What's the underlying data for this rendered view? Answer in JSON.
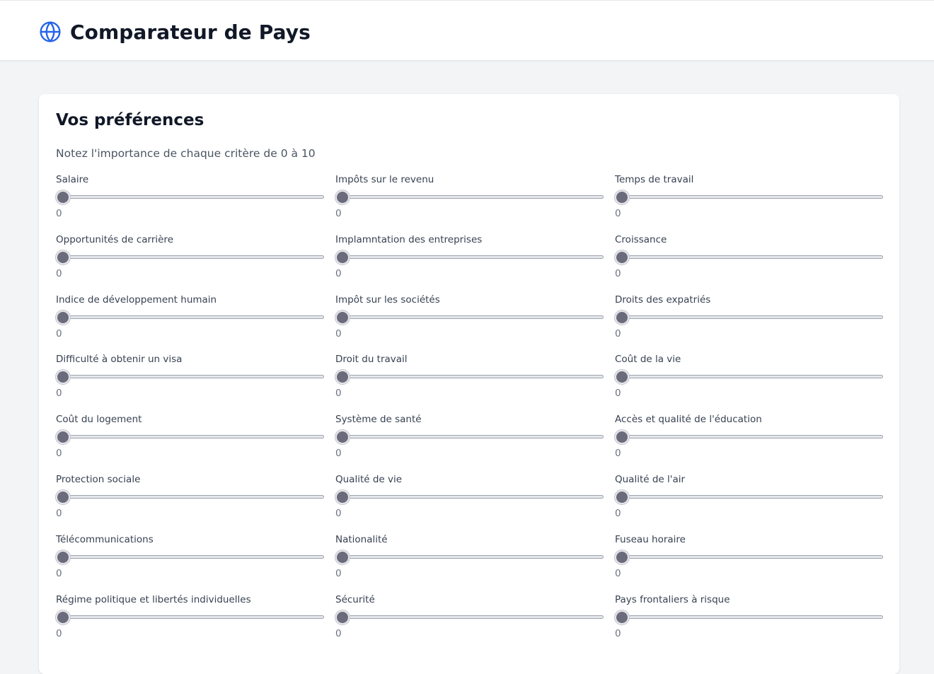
{
  "header": {
    "title": "Comparateur de Pays",
    "icon": "globe-icon",
    "accent_color": "#2563eb"
  },
  "preferences": {
    "title": "Vos préférences",
    "subtitle": "Notez l'importance de chaque critère de 0 à 10",
    "min": 0,
    "max": 10,
    "criteria": [
      {
        "label": "Salaire",
        "value": 0
      },
      {
        "label": "Impôts sur le revenu",
        "value": 0
      },
      {
        "label": "Temps de travail",
        "value": 0
      },
      {
        "label": "Opportunités de carrière",
        "value": 0
      },
      {
        "label": "Implamntation des entreprises",
        "value": 0
      },
      {
        "label": "Croissance",
        "value": 0
      },
      {
        "label": "Indice de développement humain",
        "value": 0
      },
      {
        "label": "Impôt sur les sociétés",
        "value": 0
      },
      {
        "label": "Droits des expatriés",
        "value": 0
      },
      {
        "label": "Difficulté à obtenir un visa",
        "value": 0
      },
      {
        "label": "Droit du travail",
        "value": 0
      },
      {
        "label": "Coût de la vie",
        "value": 0
      },
      {
        "label": "Coût du logement",
        "value": 0
      },
      {
        "label": "Système de santé",
        "value": 0
      },
      {
        "label": "Accès et qualité de l'éducation",
        "value": 0
      },
      {
        "label": "Protection sociale",
        "value": 0
      },
      {
        "label": "Qualité de vie",
        "value": 0
      },
      {
        "label": "Qualité de l'air",
        "value": 0
      },
      {
        "label": "Télécommunications",
        "value": 0
      },
      {
        "label": "Nationalité",
        "value": 0
      },
      {
        "label": "Fuseau horaire",
        "value": 0
      },
      {
        "label": "Régime politique et libertés individuelles",
        "value": 0
      },
      {
        "label": "Sécurité",
        "value": 0
      },
      {
        "label": "Pays frontaliers à risque",
        "value": 0
      }
    ]
  }
}
